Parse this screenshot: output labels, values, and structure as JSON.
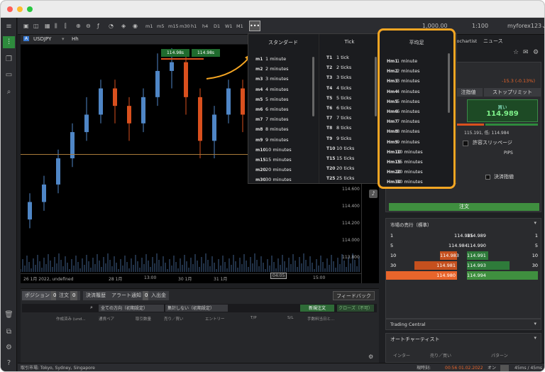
{
  "toolbar": {
    "timeframes": [
      "m1",
      "m5",
      "m15",
      "m30",
      "h1",
      "h4",
      "D1",
      "W1",
      "M1"
    ],
    "more_label": "•••",
    "account": "myforex123",
    "balance_prefix": "1,000.00",
    "leverage": "1:100",
    "chart_tab": "tochartist",
    "news_tab": "ニュース"
  },
  "chart_header": {
    "symbol": "USDJPY",
    "timeframe": "Hh",
    "flag": "A"
  },
  "trade_buttons": {
    "sell": "114.98s",
    "buy": "114.98s"
  },
  "chart": {
    "price_labels": [
      "114.600",
      "114.400",
      "114.200",
      "114.000",
      "113.800"
    ],
    "time_labels": [
      "26 1月 2022, undefined",
      "28 1月",
      "13:00",
      "30 1月",
      "31 1月",
      "15:00"
    ],
    "cursor_time": "04:05",
    "candles": [
      {
        "o": 114.0,
        "c": 114.1,
        "h": 114.15,
        "l": 113.95,
        "up": true
      },
      {
        "o": 114.1,
        "c": 114.2,
        "h": 114.25,
        "l": 114.05,
        "up": true
      },
      {
        "o": 114.2,
        "c": 114.35,
        "h": 114.4,
        "l": 114.15,
        "up": true
      },
      {
        "o": 114.35,
        "c": 114.5,
        "h": 114.55,
        "l": 114.3,
        "up": true
      },
      {
        "o": 114.5,
        "c": 114.6,
        "h": 114.7,
        "l": 114.45,
        "up": true
      },
      {
        "o": 114.6,
        "c": 114.75,
        "h": 114.8,
        "l": 114.55,
        "up": true
      },
      {
        "o": 114.75,
        "c": 114.65,
        "h": 114.8,
        "l": 114.55,
        "up": false
      },
      {
        "o": 114.65,
        "c": 114.55,
        "h": 114.7,
        "l": 114.45,
        "up": false
      },
      {
        "o": 114.55,
        "c": 114.7,
        "h": 114.75,
        "l": 114.5,
        "up": true
      },
      {
        "o": 114.7,
        "c": 114.85,
        "h": 114.95,
        "l": 114.65,
        "up": true
      },
      {
        "o": 114.85,
        "c": 114.9,
        "h": 114.98,
        "l": 114.75,
        "up": true
      },
      {
        "o": 114.9,
        "c": 114.7,
        "h": 114.95,
        "l": 114.6,
        "up": false
      },
      {
        "o": 114.7,
        "c": 114.45,
        "h": 114.75,
        "l": 114.35,
        "up": false
      },
      {
        "o": 114.45,
        "c": 114.6,
        "h": 114.65,
        "l": 114.35,
        "up": true
      },
      {
        "o": 114.6,
        "c": 114.75,
        "h": 114.8,
        "l": 114.55,
        "up": true
      },
      {
        "o": 114.75,
        "c": 114.6,
        "h": 114.8,
        "l": 114.5,
        "up": false
      },
      {
        "o": 114.6,
        "c": 114.7,
        "h": 114.78,
        "l": 114.55,
        "up": true
      },
      {
        "o": 114.7,
        "c": 114.8,
        "h": 114.88,
        "l": 114.65,
        "up": true
      },
      {
        "o": 114.8,
        "c": 114.7,
        "h": 114.85,
        "l": 114.6,
        "up": false
      },
      {
        "o": 114.7,
        "c": 114.55,
        "h": 114.75,
        "l": 114.45,
        "up": false
      },
      {
        "o": 114.55,
        "c": 114.45,
        "h": 114.6,
        "l": 114.35,
        "up": false
      }
    ]
  },
  "dropdown": {
    "col1_title": "スタンダード",
    "col2_title": "Tick",
    "col3_title": "平均足",
    "col1": [
      {
        "code": "m1",
        "label": "1 minute"
      },
      {
        "code": "m2",
        "label": "2 minutes"
      },
      {
        "code": "m3",
        "label": "3 minutes"
      },
      {
        "code": "m4",
        "label": "4 minutes"
      },
      {
        "code": "m5",
        "label": "5 minutes"
      },
      {
        "code": "m6",
        "label": "6 minutes"
      },
      {
        "code": "m7",
        "label": "7 minutes"
      },
      {
        "code": "m8",
        "label": "8 minutes"
      },
      {
        "code": "m9",
        "label": "9 minutes"
      },
      {
        "code": "m10",
        "label": "10 minutes"
      },
      {
        "code": "m15",
        "label": "15 minutes"
      },
      {
        "code": "m20",
        "label": "20 minutes"
      },
      {
        "code": "m30",
        "label": "30 minutes"
      }
    ],
    "col2": [
      {
        "code": "T1",
        "label": "1 tick"
      },
      {
        "code": "T2",
        "label": "2 ticks"
      },
      {
        "code": "T3",
        "label": "3 ticks"
      },
      {
        "code": "T4",
        "label": "4 ticks"
      },
      {
        "code": "T5",
        "label": "5 ticks"
      },
      {
        "code": "T6",
        "label": "6 ticks"
      },
      {
        "code": "T7",
        "label": "7 ticks"
      },
      {
        "code": "T8",
        "label": "8 ticks"
      },
      {
        "code": "T9",
        "label": "9 ticks"
      },
      {
        "code": "T10",
        "label": "10 ticks"
      },
      {
        "code": "T15",
        "label": "15 ticks"
      },
      {
        "code": "T20",
        "label": "20 ticks"
      },
      {
        "code": "T25",
        "label": "25 ticks"
      }
    ],
    "col3": [
      {
        "code": "Hm1",
        "label": "1 minute"
      },
      {
        "code": "Hm2",
        "label": "2 minutes"
      },
      {
        "code": "Hm3",
        "label": "3 minutes"
      },
      {
        "code": "Hm4",
        "label": "4 minutes"
      },
      {
        "code": "Hm5",
        "label": "5 minutes"
      },
      {
        "code": "Hm6",
        "label": "6 minutes"
      },
      {
        "code": "Hm7",
        "label": "7 minutes"
      },
      {
        "code": "Hm8",
        "label": "8 minutes"
      },
      {
        "code": "Hm9",
        "label": "9 minutes"
      },
      {
        "code": "Hm10",
        "label": "10 minutes"
      },
      {
        "code": "Hm15",
        "label": "15 minutes"
      },
      {
        "code": "Hm20",
        "label": "20 minutes"
      },
      {
        "code": "Hm30",
        "label": "30 minutes"
      }
    ]
  },
  "right": {
    "change": "-15.3 (-0.13%)",
    "order_tab1": "注指値",
    "order_tab2": "ストップリミット",
    "buy_label": "買い",
    "buy_price": "114.989",
    "hilo": "115.191, 低: 114.984",
    "slippage": "許容スリッページ",
    "pips": "PIPS",
    "settle": "決済指値",
    "order_button": "注文",
    "depth_title": "市場の売行（標準）",
    "trading_central": "Trading Central",
    "autochartist": "オートチャーティスト",
    "auto_cols": [
      "インター",
      "売り／買い",
      "パターン"
    ],
    "sell_depth": [
      {
        "qty": "1",
        "price": "114.985"
      },
      {
        "qty": "5",
        "price": "114.984"
      },
      {
        "qty": "10",
        "price": "114.983"
      },
      {
        "qty": "30",
        "price": "114.981"
      },
      {
        "qty": "50",
        "price": "114.980"
      }
    ],
    "buy_depth": [
      {
        "qty": "1",
        "price": "114.989"
      },
      {
        "qty": "5",
        "price": "114.990"
      },
      {
        "qty": "10",
        "price": "114.991"
      },
      {
        "qty": "30",
        "price": "114.993"
      },
      {
        "qty": "50",
        "price": "114.994"
      }
    ]
  },
  "bottom": {
    "tabs": [
      {
        "label": "ポジション",
        "count": "0"
      },
      {
        "label": "注文",
        "count": "0"
      },
      {
        "label": "決済履歴",
        "count": ""
      },
      {
        "label": "アラート通知",
        "count": "0"
      },
      {
        "label": "入出金",
        "count": ""
      }
    ],
    "feedback": "フィードバック",
    "filter1": "全ての方向（初期設定）",
    "filter2": "集計しない（初期設定）",
    "new_order": "新規注文",
    "close_all": "クローズ（不可）",
    "columns": [
      "作成済み (und...",
      "通貨ペア",
      "取引数量",
      "売り／買い",
      "エントリー",
      "T/P",
      "S/L",
      "手数料当日と..."
    ]
  },
  "status": {
    "market": "取引市場: Tokyo, Sydney, Singapore",
    "time_label": "現時刻:",
    "time": "00:56 01.02.2022",
    "on_label": "オン",
    "latency": "45ms / 45ms"
  },
  "colors": {
    "up": "#4f86c6",
    "down": "#d9501e",
    "buy": "#1d6b2a",
    "accent": "#f5a623"
  }
}
